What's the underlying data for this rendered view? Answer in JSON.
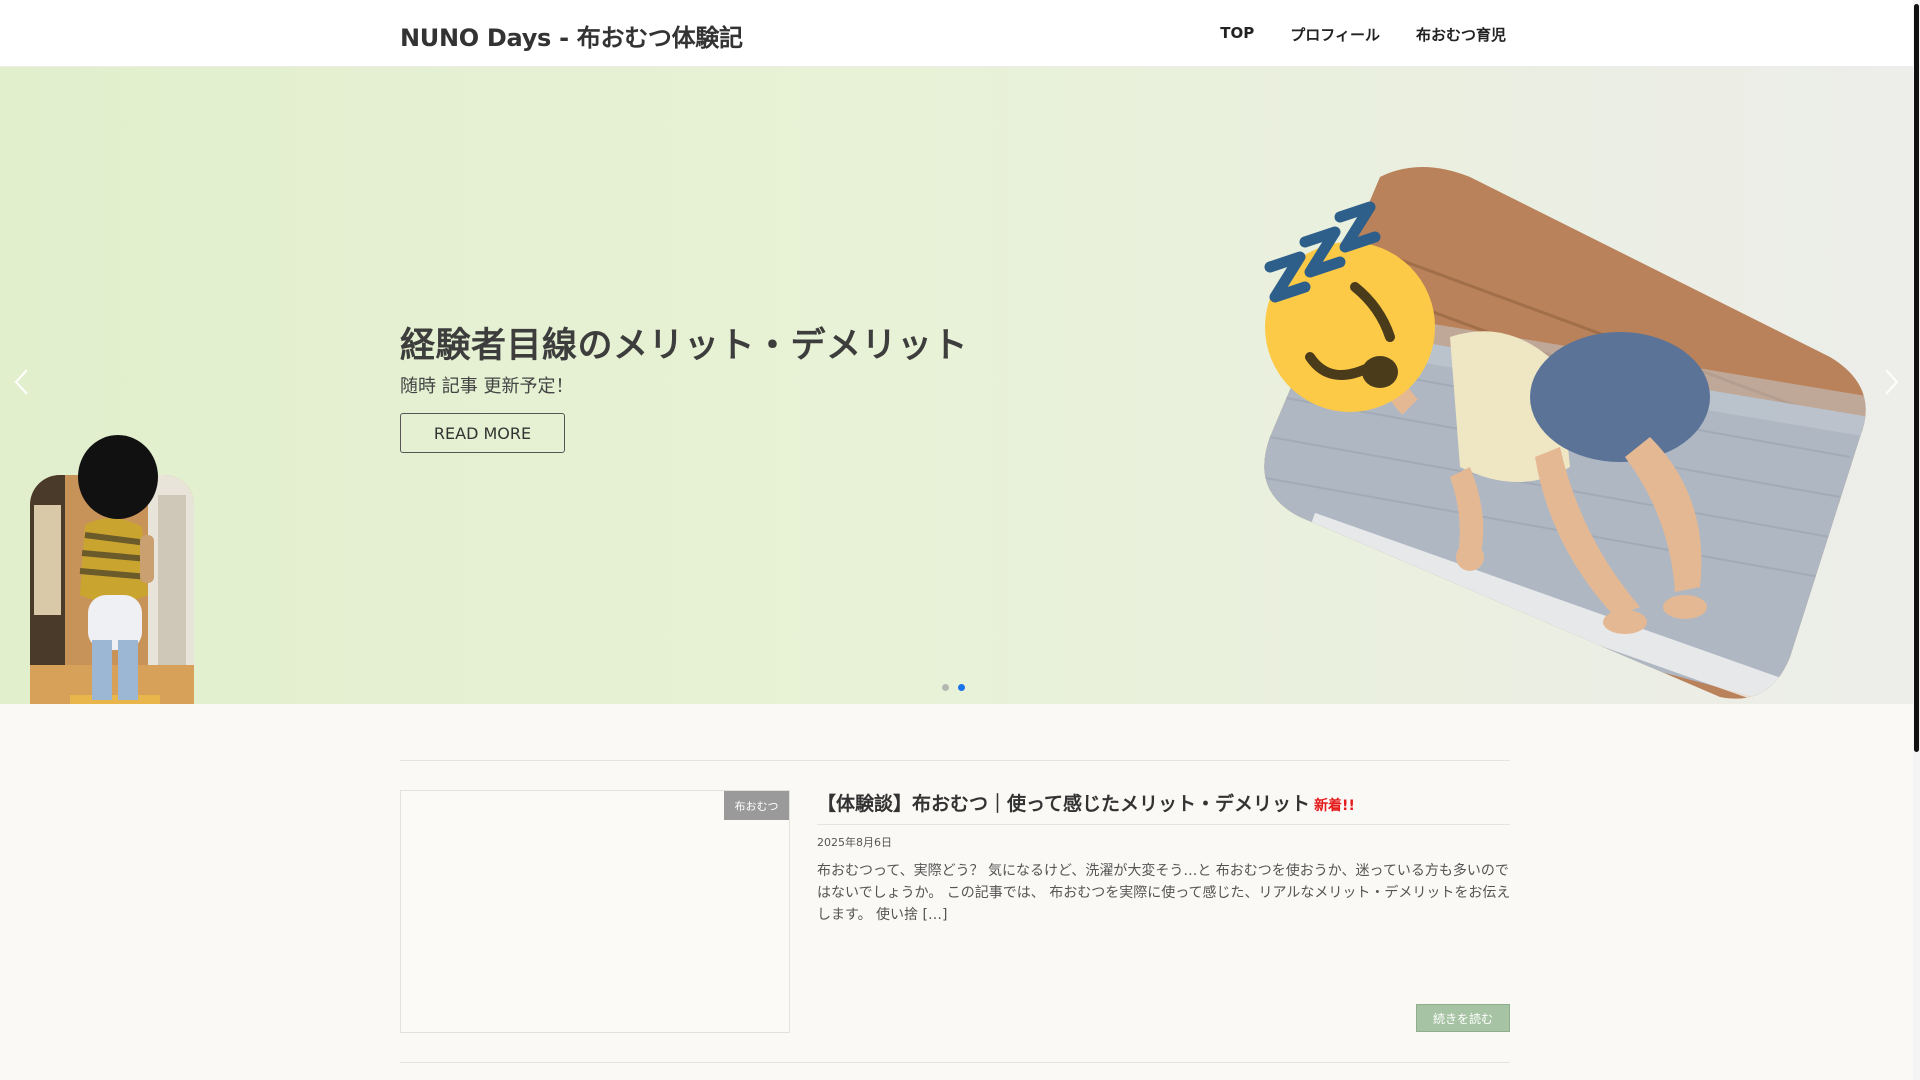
{
  "header": {
    "site_title": "NUNO Days - 布おむつ体験記",
    "nav": [
      "TOP",
      "プロフィール",
      "布おむつ育児"
    ]
  },
  "hero": {
    "title": "経験者目線のメリット・デメリット",
    "subtitle": "随時 記事 更新予定！",
    "button_label": "READ MORE",
    "slides_count": 2,
    "active_slide": 2,
    "colors": {
      "active_dot": "#1a73e8"
    }
  },
  "post": {
    "category": "布おむつ",
    "title": "【体験談】布おむつ｜使って感じたメリット・デメリット",
    "new_badge": "新着!!",
    "date": "2025年8月6日",
    "excerpt": "布おむつって、実際どう？ 気になるけど、洗濯が大変そう…と 布おむつを使おうか、迷っている方も多いのではないでしょうか。 この記事では、 布おむつを実際に使って感じた、リアルなメリット・デメリットをお伝えします。 使い捨 […]",
    "continue_label": "続きを読む"
  },
  "icons": [
    "chevron-left-icon",
    "chevron-right-icon",
    "sleeping-face-icon"
  ]
}
